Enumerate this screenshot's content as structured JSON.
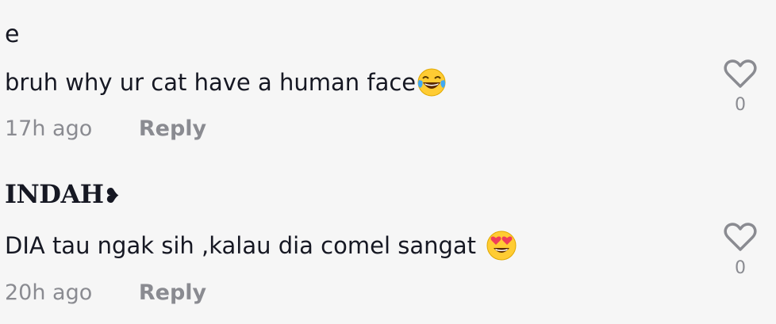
{
  "comments": [
    {
      "username": "e",
      "text": "bruh why ur cat have a human face",
      "emoji": "face-with-tears-of-joy",
      "time": "17h ago",
      "reply_label": "Reply",
      "like_count": "0"
    },
    {
      "username": "INDAH",
      "username_symbol": "❥",
      "text": "DIA tau ngak sih ,kalau dia comel sangat",
      "emoji": "smiling-face-with-heart-eyes",
      "time": "20h ago",
      "reply_label": "Reply",
      "like_count": "0"
    }
  ],
  "colors": {
    "background": "#f6f6f6",
    "text": "#161823",
    "muted": "#8a8b91",
    "emoji_face": "#ffcc33",
    "emoji_heart": "#ef3d5a",
    "emoji_tear": "#3fa9f5"
  }
}
